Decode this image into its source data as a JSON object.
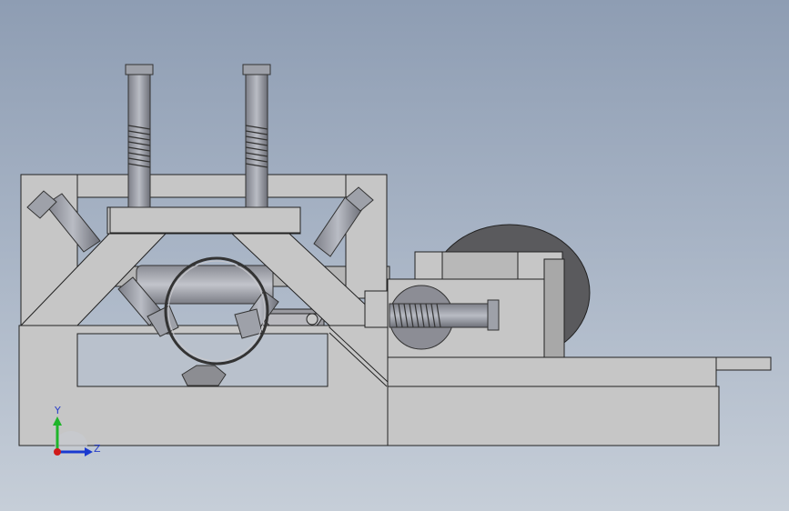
{
  "viewport": {
    "background_top": "#8e9db3",
    "background_bottom": "#c6ced8"
  },
  "model": {
    "part_fill": "#c6c6c6",
    "part_stroke": "#222222",
    "shadow_fill": "#8f8f94",
    "disc_fill": "#5a5a5d"
  },
  "triad": {
    "y_label": "Y",
    "z_label": "Z",
    "y_color": "#1fb52a",
    "z_color": "#1a3ad0",
    "x_color": "#d01a1a"
  }
}
